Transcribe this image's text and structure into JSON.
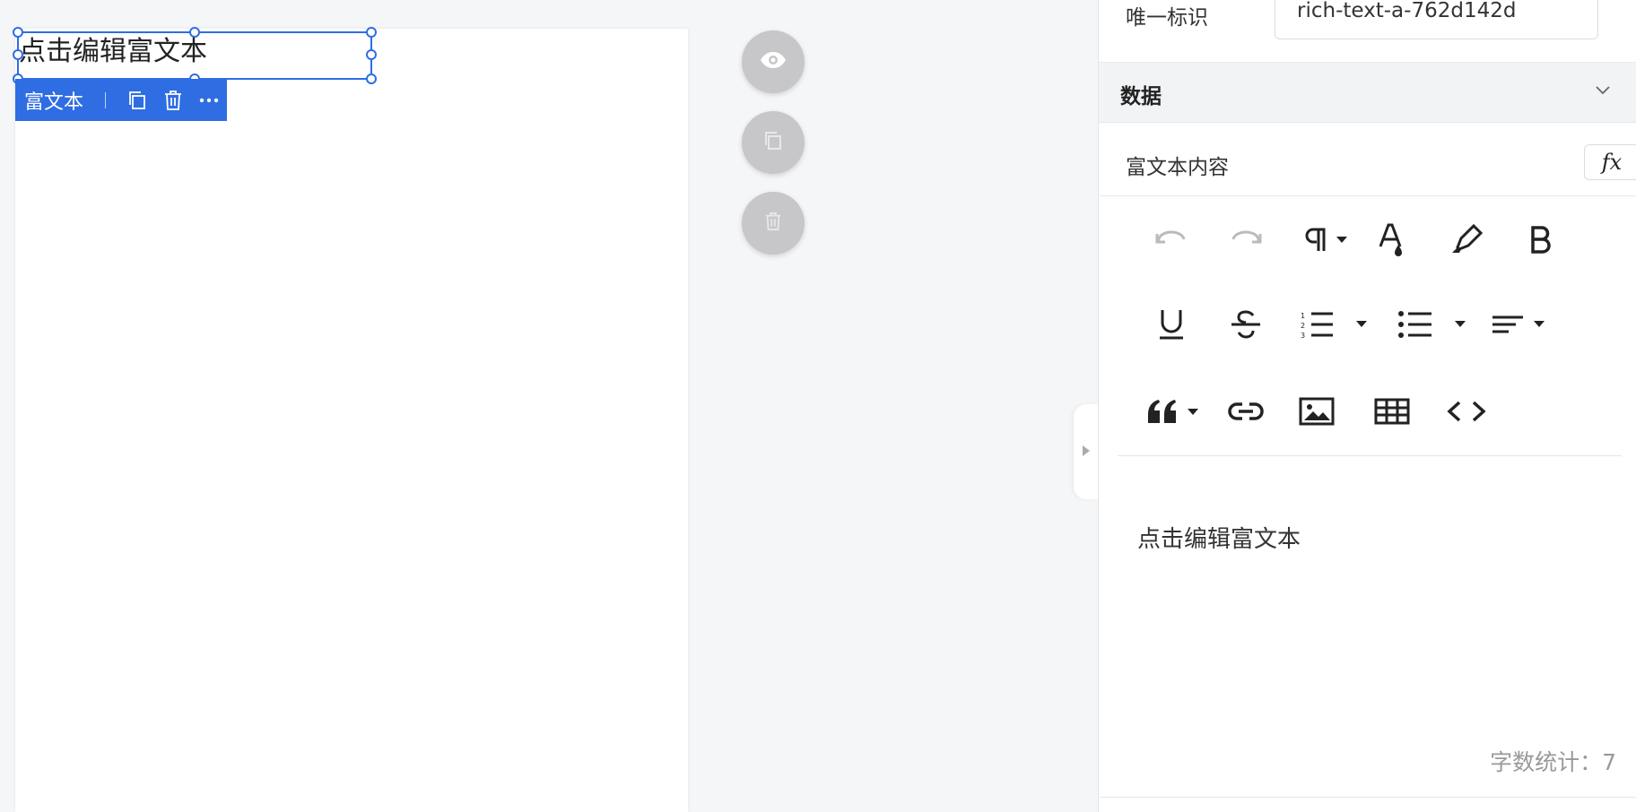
{
  "canvas": {
    "selected_text": "点击编辑富文本",
    "component_toolbar": {
      "name": "富文本"
    }
  },
  "panel": {
    "unique_id": {
      "label": "唯一标识",
      "value": "rich-text-a-762d142d"
    },
    "section": {
      "title": "数据"
    },
    "content_field": {
      "label": "富文本内容",
      "fx_label": "fx"
    },
    "editor": {
      "content": "点击编辑富文本",
      "word_count": "字数统计：7"
    }
  },
  "icons": {
    "floating": [
      "eye-icon",
      "copy-icon",
      "trash-icon"
    ],
    "toolbar_row1": [
      "undo-icon",
      "redo-icon",
      "paragraph-icon",
      "font-color-icon",
      "highlight-icon",
      "bold-icon"
    ],
    "toolbar_row2": [
      "underline-icon",
      "strikethrough-icon",
      "ordered-list-icon",
      "unordered-list-icon",
      "align-icon"
    ],
    "toolbar_row3": [
      "quote-icon",
      "link-icon",
      "image-icon",
      "table-icon",
      "code-icon"
    ]
  },
  "colors": {
    "accent": "#2f6de3",
    "float_btn": "#c7c7c9",
    "panel_bg": "#f2f3f5"
  }
}
